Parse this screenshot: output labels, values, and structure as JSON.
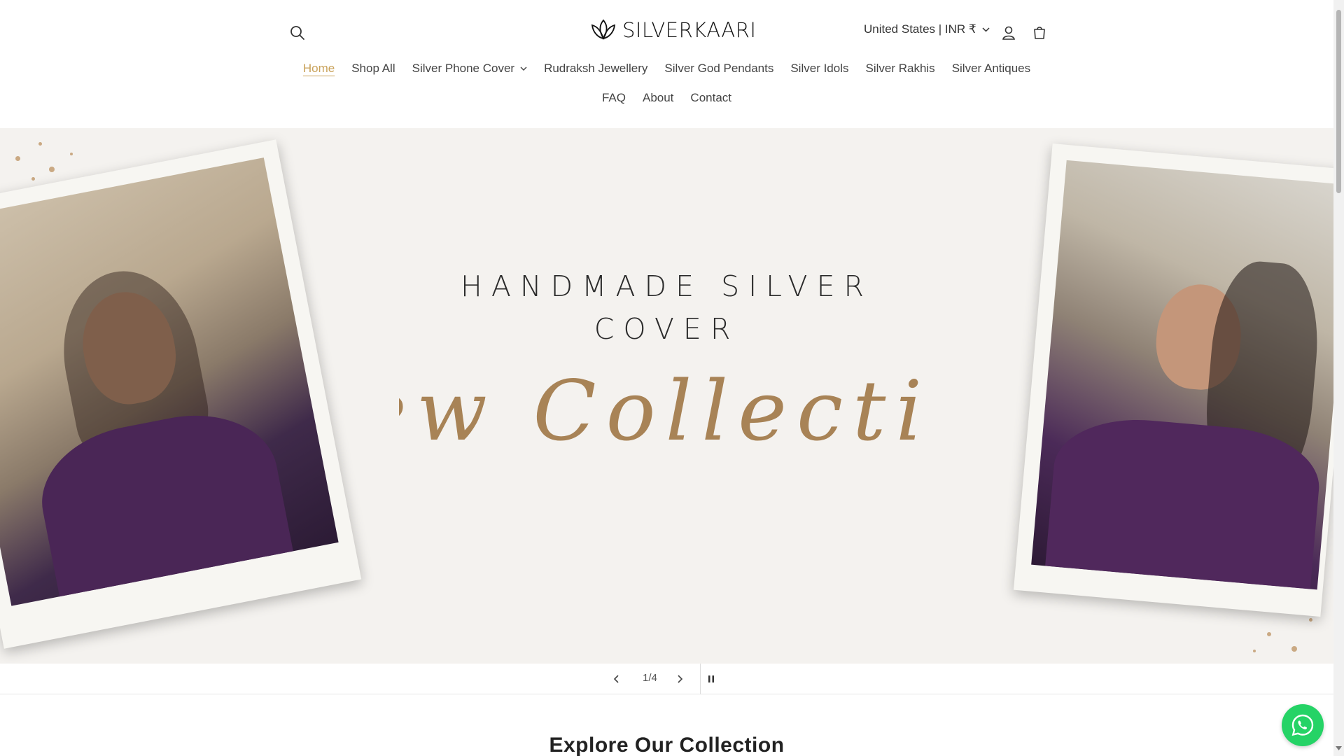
{
  "header": {
    "logo_text": "SILVERKAARI",
    "country_selector": "United States | INR ₹"
  },
  "nav": {
    "row1": [
      {
        "label": "Home",
        "active": true
      },
      {
        "label": "Shop All"
      },
      {
        "label": "Silver Phone Cover",
        "dropdown": true
      },
      {
        "label": "Rudraksh Jewellery"
      },
      {
        "label": "Silver God Pendants"
      },
      {
        "label": "Silver Idols"
      },
      {
        "label": "Silver Rakhis"
      },
      {
        "label": "Silver Antiques"
      }
    ],
    "row2": [
      {
        "label": "FAQ"
      },
      {
        "label": "About"
      },
      {
        "label": "Contact"
      }
    ]
  },
  "hero": {
    "title_line1": "HANDMADE SILVER",
    "title_line2": "COVER",
    "script_text": "New Collection"
  },
  "slider": {
    "counter": "1/4"
  },
  "section": {
    "heading": "Explore Our Collection"
  },
  "icons": {
    "search": "search-icon",
    "account": "account-icon",
    "cart": "cart-icon",
    "chat": "whatsapp-icon",
    "prev": "chevron-left-icon",
    "next": "chevron-right-icon",
    "pause": "pause-icon"
  },
  "colors": {
    "accent": "#c9a25a",
    "hero_bg": "#f4f2ef",
    "script": "#a88356",
    "whatsapp": "#25d366"
  }
}
